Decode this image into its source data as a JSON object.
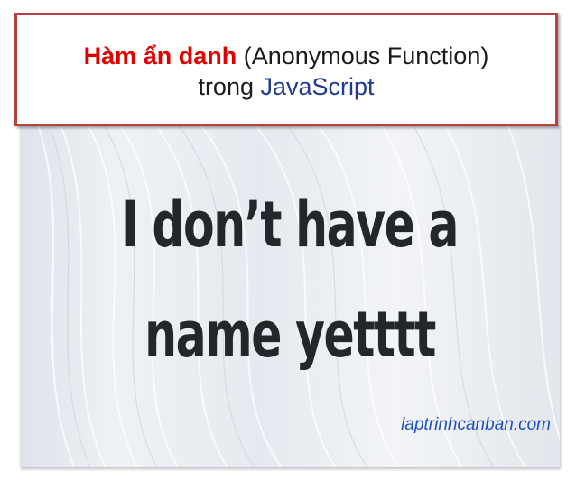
{
  "title": {
    "highlight": "Hàm ẩn danh",
    "paren": " (Anonymous Function)",
    "line2_prefix": "trong ",
    "line2_lang": "JavaScript"
  },
  "image": {
    "line1": "I don’t have a",
    "line2": "name yetttt",
    "website": "laptrinhcanban.com"
  },
  "colors": {
    "title_border": "#b8403f",
    "highlight": "#e00000",
    "language": "#1f3a8f",
    "website": "#1b4fc4",
    "big_text": "#23272c"
  }
}
